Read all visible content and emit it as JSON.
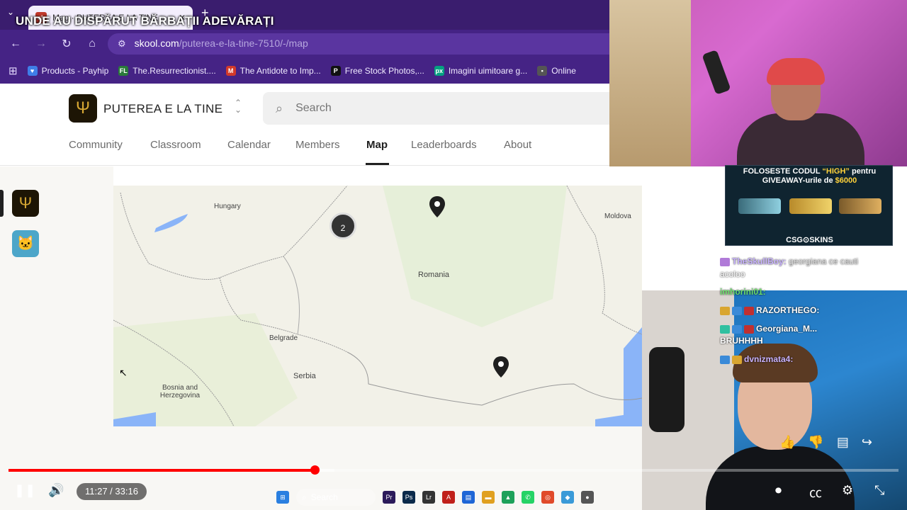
{
  "video_title": "UNDE AU DISPĂRUT BĂRBAȚII ADEVĂRAȚI",
  "browser": {
    "tab_title": "Map · PUTEREA E LA TINE",
    "favicon_text": "sk",
    "url_host": "skool.com",
    "url_path": "/puterea-e-la-tine-7510/-/map",
    "bookmarks": [
      {
        "label": "Products - Payhip",
        "color": "#3f7ee8"
      },
      {
        "label": "The.Resurrectionist....",
        "color": "#2a7a3a"
      },
      {
        "label": "The Antidote to Imp...",
        "color": "#d23a2a"
      },
      {
        "label": "Free Stock Photos,...",
        "color": "#111111"
      },
      {
        "label": "Imagini uimitoare g...",
        "color": "#05a081"
      },
      {
        "label": "Online",
        "color": "#555555"
      }
    ]
  },
  "skool": {
    "group_name": "PUTEREA E LA TINE",
    "search_placeholder": "Search",
    "tabs": [
      "Community",
      "Classroom",
      "Calendar",
      "Members",
      "Map",
      "Leaderboards",
      "About"
    ],
    "active_tab": "Map"
  },
  "map": {
    "labels": {
      "hungary": "Hungary",
      "moldova": "Moldova",
      "romania": "Romania",
      "belgrade": "Belgrade",
      "serbia": "Serbia",
      "bosnia": "Bosnia and Herzegovina"
    },
    "cluster_count": "2",
    "pin_color": "#1f1f1f"
  },
  "stream": {
    "promo_line1": "FOLOSESTE CODUL",
    "promo_code": "“HIGH”",
    "promo_line1b": "pentru",
    "promo_line2": "GIVEAWAY-urile de",
    "promo_amount": "$6000",
    "promo_brand": "CSG⊙SKINS",
    "chat": [
      {
        "user": "TheSkullBoy:",
        "msg": "georgiana ce cauti"
      },
      {
        "user": "",
        "msg": "acoloo"
      },
      {
        "user": "imhorini01:",
        "msg": ""
      },
      {
        "user": "RAZORTHEGO:",
        "msg": ""
      },
      {
        "user": "Georgiana_M...",
        "msg": ""
      },
      {
        "user": "",
        "msg": "BRUHHHH"
      },
      {
        "user": "dvnizmata4:",
        "msg": ""
      }
    ]
  },
  "player": {
    "time": "11:27 / 33:16",
    "progress_fraction": 0.344,
    "buffered_fraction": 0.366,
    "accent": "#ff0000"
  },
  "taskbar": {
    "search_label": "Search"
  }
}
